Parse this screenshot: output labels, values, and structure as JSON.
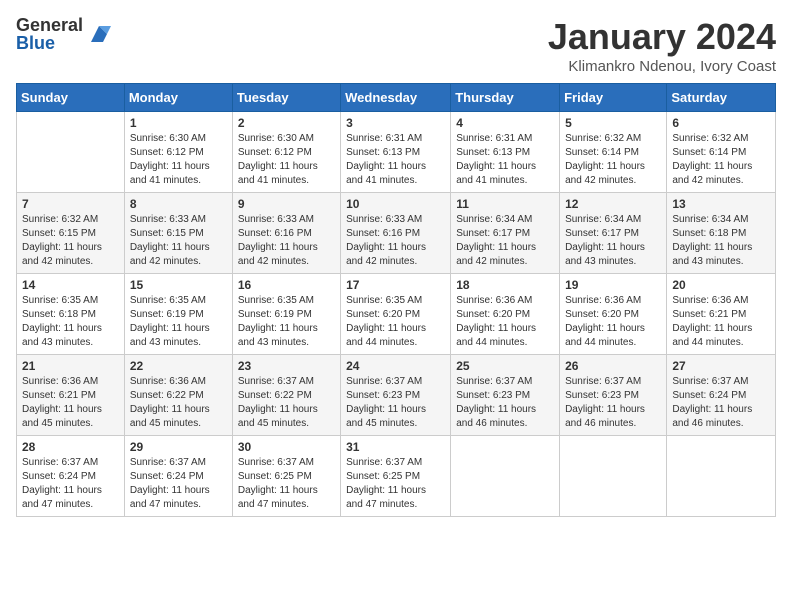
{
  "logo": {
    "general": "General",
    "blue": "Blue"
  },
  "title": "January 2024",
  "subtitle": "Klimankro Ndenou, Ivory Coast",
  "days_header": [
    "Sunday",
    "Monday",
    "Tuesday",
    "Wednesday",
    "Thursday",
    "Friday",
    "Saturday"
  ],
  "weeks": [
    [
      {
        "num": "",
        "info": ""
      },
      {
        "num": "1",
        "info": "Sunrise: 6:30 AM\nSunset: 6:12 PM\nDaylight: 11 hours\nand 41 minutes."
      },
      {
        "num": "2",
        "info": "Sunrise: 6:30 AM\nSunset: 6:12 PM\nDaylight: 11 hours\nand 41 minutes."
      },
      {
        "num": "3",
        "info": "Sunrise: 6:31 AM\nSunset: 6:13 PM\nDaylight: 11 hours\nand 41 minutes."
      },
      {
        "num": "4",
        "info": "Sunrise: 6:31 AM\nSunset: 6:13 PM\nDaylight: 11 hours\nand 41 minutes."
      },
      {
        "num": "5",
        "info": "Sunrise: 6:32 AM\nSunset: 6:14 PM\nDaylight: 11 hours\nand 42 minutes."
      },
      {
        "num": "6",
        "info": "Sunrise: 6:32 AM\nSunset: 6:14 PM\nDaylight: 11 hours\nand 42 minutes."
      }
    ],
    [
      {
        "num": "7",
        "info": "Sunrise: 6:32 AM\nSunset: 6:15 PM\nDaylight: 11 hours\nand 42 minutes."
      },
      {
        "num": "8",
        "info": "Sunrise: 6:33 AM\nSunset: 6:15 PM\nDaylight: 11 hours\nand 42 minutes."
      },
      {
        "num": "9",
        "info": "Sunrise: 6:33 AM\nSunset: 6:16 PM\nDaylight: 11 hours\nand 42 minutes."
      },
      {
        "num": "10",
        "info": "Sunrise: 6:33 AM\nSunset: 6:16 PM\nDaylight: 11 hours\nand 42 minutes."
      },
      {
        "num": "11",
        "info": "Sunrise: 6:34 AM\nSunset: 6:17 PM\nDaylight: 11 hours\nand 42 minutes."
      },
      {
        "num": "12",
        "info": "Sunrise: 6:34 AM\nSunset: 6:17 PM\nDaylight: 11 hours\nand 43 minutes."
      },
      {
        "num": "13",
        "info": "Sunrise: 6:34 AM\nSunset: 6:18 PM\nDaylight: 11 hours\nand 43 minutes."
      }
    ],
    [
      {
        "num": "14",
        "info": "Sunrise: 6:35 AM\nSunset: 6:18 PM\nDaylight: 11 hours\nand 43 minutes."
      },
      {
        "num": "15",
        "info": "Sunrise: 6:35 AM\nSunset: 6:19 PM\nDaylight: 11 hours\nand 43 minutes."
      },
      {
        "num": "16",
        "info": "Sunrise: 6:35 AM\nSunset: 6:19 PM\nDaylight: 11 hours\nand 43 minutes."
      },
      {
        "num": "17",
        "info": "Sunrise: 6:35 AM\nSunset: 6:20 PM\nDaylight: 11 hours\nand 44 minutes."
      },
      {
        "num": "18",
        "info": "Sunrise: 6:36 AM\nSunset: 6:20 PM\nDaylight: 11 hours\nand 44 minutes."
      },
      {
        "num": "19",
        "info": "Sunrise: 6:36 AM\nSunset: 6:20 PM\nDaylight: 11 hours\nand 44 minutes."
      },
      {
        "num": "20",
        "info": "Sunrise: 6:36 AM\nSunset: 6:21 PM\nDaylight: 11 hours\nand 44 minutes."
      }
    ],
    [
      {
        "num": "21",
        "info": "Sunrise: 6:36 AM\nSunset: 6:21 PM\nDaylight: 11 hours\nand 45 minutes."
      },
      {
        "num": "22",
        "info": "Sunrise: 6:36 AM\nSunset: 6:22 PM\nDaylight: 11 hours\nand 45 minutes."
      },
      {
        "num": "23",
        "info": "Sunrise: 6:37 AM\nSunset: 6:22 PM\nDaylight: 11 hours\nand 45 minutes."
      },
      {
        "num": "24",
        "info": "Sunrise: 6:37 AM\nSunset: 6:23 PM\nDaylight: 11 hours\nand 45 minutes."
      },
      {
        "num": "25",
        "info": "Sunrise: 6:37 AM\nSunset: 6:23 PM\nDaylight: 11 hours\nand 46 minutes."
      },
      {
        "num": "26",
        "info": "Sunrise: 6:37 AM\nSunset: 6:23 PM\nDaylight: 11 hours\nand 46 minutes."
      },
      {
        "num": "27",
        "info": "Sunrise: 6:37 AM\nSunset: 6:24 PM\nDaylight: 11 hours\nand 46 minutes."
      }
    ],
    [
      {
        "num": "28",
        "info": "Sunrise: 6:37 AM\nSunset: 6:24 PM\nDaylight: 11 hours\nand 47 minutes."
      },
      {
        "num": "29",
        "info": "Sunrise: 6:37 AM\nSunset: 6:24 PM\nDaylight: 11 hours\nand 47 minutes."
      },
      {
        "num": "30",
        "info": "Sunrise: 6:37 AM\nSunset: 6:25 PM\nDaylight: 11 hours\nand 47 minutes."
      },
      {
        "num": "31",
        "info": "Sunrise: 6:37 AM\nSunset: 6:25 PM\nDaylight: 11 hours\nand 47 minutes."
      },
      {
        "num": "",
        "info": ""
      },
      {
        "num": "",
        "info": ""
      },
      {
        "num": "",
        "info": ""
      }
    ]
  ]
}
